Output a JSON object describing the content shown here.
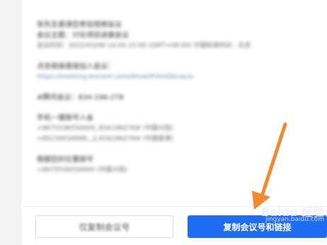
{
  "content": {
    "blocks": [
      {
        "lines": [
          {
            "text": "张先生邀请您参加视频会议",
            "kind": "text"
          },
          {
            "text": "会议主题：讨论项目进展会议",
            "kind": "text"
          },
          {
            "text": "会议时间：2022/03/08 14:00-15:00 (GMT+08:00) 中国标准时间 - 北京",
            "kind": "muted"
          }
        ]
      },
      {
        "lines": [
          {
            "text": "点击链接直接加入会议：",
            "kind": "text"
          },
          {
            "text": "https://meeting.tencent.com/dm/wVhXmQbcqLzv",
            "kind": "link"
          }
        ]
      },
      {
        "lines": [
          {
            "text": "#腾讯会议：834-196-278",
            "kind": "text"
          }
        ]
      },
      {
        "lines": [
          {
            "text": "手机一键拨号入会",
            "kind": "text"
          },
          {
            "text": "+8675536550000,,834196278# (中国大陆)",
            "kind": "muted"
          },
          {
            "text": "+85230018898,,,2,834196278# (中国香港)",
            "kind": "muted"
          }
        ]
      },
      {
        "lines": [
          {
            "text": "根据您的位置拨号",
            "kind": "text"
          },
          {
            "text": "+8675536550000 (中国大陆)",
            "kind": "muted"
          }
        ]
      }
    ]
  },
  "buttons": {
    "secondary_label": "仅复制会议号",
    "primary_label": "复制会议号和链接"
  },
  "watermark": {
    "logo": "Baidu 经验",
    "url": "jingyan.baidu.com"
  },
  "colors": {
    "primary": "#1f6df2",
    "arrow": "#f2892f"
  }
}
